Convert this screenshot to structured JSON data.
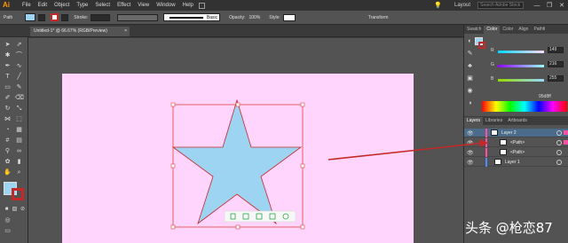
{
  "app": {
    "logo": "Ai"
  },
  "menu": [
    "File",
    "Edit",
    "Object",
    "Type",
    "Select",
    "Effect",
    "View",
    "Window",
    "Help"
  ],
  "menubar_right": {
    "layout": "Layout",
    "search_placeholder": "Search Adobe Stock",
    "minimize": "—",
    "restore": "❐",
    "close": "✕"
  },
  "control": {
    "object_label": "Path",
    "stroke_label": "Stroke:",
    "profile_label": "Basic",
    "opacity_label": "Opacity:",
    "opacity_value": "100%",
    "style_label": "Style:",
    "transform_label": "Transform"
  },
  "document": {
    "tab_title": "Untitled-1* @ 66.67% (RGB/Preview)",
    "close": "×"
  },
  "colors": {
    "fill": "#9dd4f2",
    "stroke": "#c62828",
    "artboard": "#ffd5fd"
  },
  "color_panel": {
    "tabs": [
      "Swatch",
      "Color",
      "Color",
      "Align",
      "Pathfi"
    ],
    "channels": [
      {
        "name": "R",
        "value": "149"
      },
      {
        "name": "G",
        "value": "216"
      },
      {
        "name": "B",
        "value": "255"
      }
    ],
    "hex": "95d8ff"
  },
  "layers_panel": {
    "tabs": [
      "Layers",
      "Libraries",
      "Artboards"
    ],
    "rows": [
      {
        "name": "Layer 2",
        "color": "#ff4fa3",
        "selected": true
      },
      {
        "name": "<Path>",
        "color": "#ff4fa3",
        "selected": false
      },
      {
        "name": "<Path>",
        "color": "#ff4fa3",
        "selected": false
      },
      {
        "name": "Layer 1",
        "color": "#4f8cff",
        "selected": false
      }
    ]
  },
  "watermark": "头条 @枪恋87"
}
